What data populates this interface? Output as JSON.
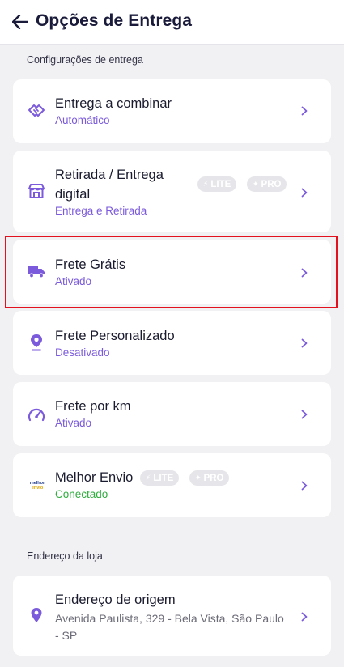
{
  "header": {
    "title": "Opções de Entrega",
    "back_icon": "arrow-left-icon"
  },
  "sections": {
    "delivery_settings": "Configurações de entrega",
    "store_address": "Endereço da loja"
  },
  "badges": {
    "lite": "LITE",
    "pro": "PRO"
  },
  "options": [
    {
      "title": "Entrega a combinar",
      "subtitle": "Automático",
      "icon": "handshake-icon"
    },
    {
      "title_line1": "Retirada / Entrega",
      "title_line2": "digital",
      "subtitle": "Entrega e Retirada",
      "icon": "store-icon"
    },
    {
      "title": "Frete Grátis",
      "subtitle": "Ativado",
      "icon": "truck-icon"
    },
    {
      "title": "Frete Personalizado",
      "subtitle": "Desativado",
      "icon": "location-pin-icon"
    },
    {
      "title": "Frete por km",
      "subtitle": "Ativado",
      "icon": "speedometer-icon"
    },
    {
      "title": "Melhor Envio",
      "subtitle": "Conectado",
      "icon": "melhor-envio-logo",
      "logo_text_1": "melhor",
      "logo_text_2": "envio"
    }
  ],
  "address": {
    "title": "Endereço de origem",
    "line1": "Avenida Paulista, 329 - Bela Vista, São Paulo",
    "line2": "- SP",
    "icon": "map-pin-icon"
  },
  "colors": {
    "accent": "#7b5bdc",
    "connected": "#2fae3e",
    "highlight_border": "#e3111d",
    "background": "#f1f1f4"
  }
}
